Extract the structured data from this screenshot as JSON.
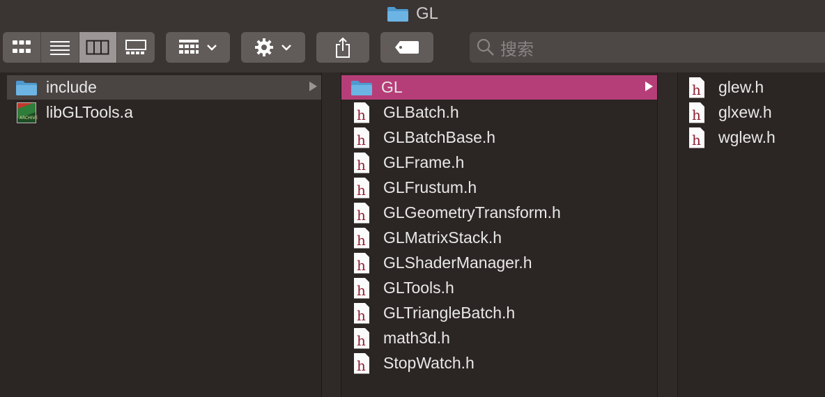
{
  "window": {
    "title": "GL"
  },
  "toolbar": {
    "view_modes": [
      "icon-view",
      "list-view",
      "column-view",
      "gallery-view"
    ],
    "active_view": "column-view",
    "group_button": "group-by",
    "action_button": "action-gear",
    "share_button": "share",
    "tag_button": "tags"
  },
  "search": {
    "placeholder": "搜索"
  },
  "columns": [
    {
      "items": [
        {
          "name": "include",
          "type": "folder",
          "selected": "inactive",
          "has_children": true
        },
        {
          "name": "libGLTools.a",
          "type": "archive"
        }
      ]
    },
    {
      "items": [
        {
          "name": "GL",
          "type": "folder",
          "selected": "active",
          "has_children": true
        },
        {
          "name": "GLBatch.h",
          "type": "header"
        },
        {
          "name": "GLBatchBase.h",
          "type": "header"
        },
        {
          "name": "GLFrame.h",
          "type": "header"
        },
        {
          "name": "GLFrustum.h",
          "type": "header"
        },
        {
          "name": "GLGeometryTransform.h",
          "type": "header"
        },
        {
          "name": "GLMatrixStack.h",
          "type": "header"
        },
        {
          "name": "GLShaderManager.h",
          "type": "header"
        },
        {
          "name": "GLTools.h",
          "type": "header"
        },
        {
          "name": "GLTriangleBatch.h",
          "type": "header"
        },
        {
          "name": "math3d.h",
          "type": "header"
        },
        {
          "name": "StopWatch.h",
          "type": "header"
        }
      ]
    },
    {
      "items": [
        {
          "name": "glew.h",
          "type": "header"
        },
        {
          "name": "glxew.h",
          "type": "header"
        },
        {
          "name": "wglew.h",
          "type": "header"
        }
      ]
    }
  ],
  "icon_glyphs": {
    "header_letter": "h",
    "archive_text": "ARCHIVE"
  },
  "colors": {
    "selection_active": "#b63e78",
    "selection_inactive": "#4a4443",
    "folder_blue": "#6cb4e4",
    "header_letter": "#8e1f32"
  }
}
